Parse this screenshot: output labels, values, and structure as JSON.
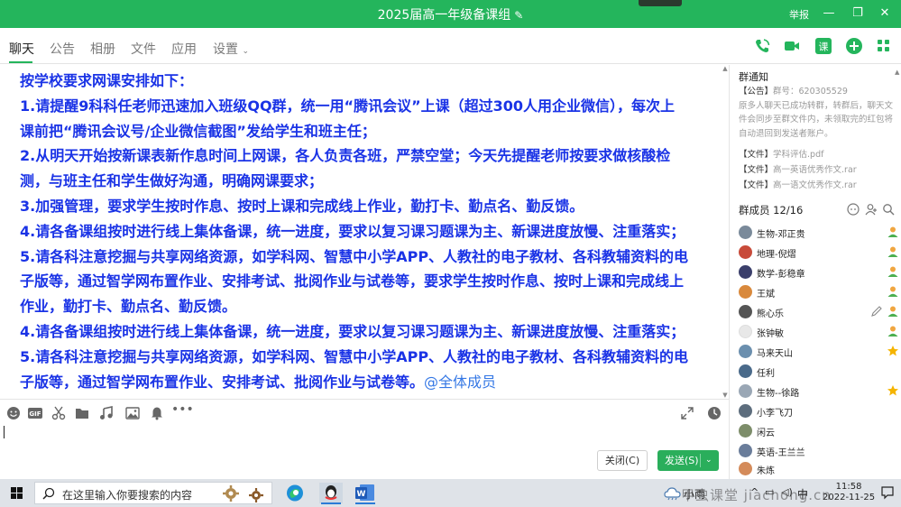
{
  "window": {
    "title": "2025届高一年级备课组",
    "report": "举报",
    "colors": {
      "titlebar": "#24b55c",
      "message": "#1a33e6",
      "send": "#2aae5b"
    }
  },
  "tabs": [
    "聊天",
    "公告",
    "相册",
    "文件",
    "应用",
    "设置"
  ],
  "message": {
    "lines": [
      "按学校要求网课安排如下：",
      "1.请提醒9科科任老师迅速加入班级QQ群，统一用“腾讯会议”上课（超过300人用企业微信），每次上",
      "课前把“腾讯会议号/企业微信截图”发给学生和班主任；",
      "2.从明天开始按新课表新作息时间上网课，各人负责各班，严禁空堂；今天先提醒老师按要求做核酸检",
      "测，与班主任和学生做好沟通，明确网课要求；",
      "3.加强管理，要求学生按时作息、按时上课和完成线上作业，勤打卡、勤点名、勤反馈。",
      "4.请各备课组按时进行线上集体备课，统一进度，要求以复习课习题课为主、新课进度放慢、注重落实；",
      "5.请各科注意挖掘与共享网络资源，如学科网、智慧中小学APP、人教社的电子教材、各科教辅资料的电",
      "子版等，通过智学网布置作业、安排考试、批阅作业与试卷等，要求学生按时作息、按时上课和完成线上",
      "作业，勤打卡、勤点名、勤反馈。",
      "4.请各备课组按时进行线上集体备课，统一进度，要求以复习课习题课为主、新课进度放慢、注重落实；",
      "5.请各科注意挖掘与共享网络资源，如学科网、智慧中小学APP、人教社的电子教材、各科教辅资料的电",
      "子版等，通过智学网布置作业、安排考试、批阅作业与试卷等。"
    ],
    "mention": "@全体成员"
  },
  "buttons": {
    "close": "关闭(C)",
    "send": "发送(S)"
  },
  "side": {
    "notice_title": "群通知",
    "notice_tag": "【公告】",
    "notice_group_label": "群号：620305529",
    "notice_body": "原多人聊天已成功转群，转群后，聊天文件会同步至群文件内，未领取完的红包将自动退回到发送者账户。",
    "files": [
      {
        "tag": "【文件】",
        "name": "学科评估.pdf"
      },
      {
        "tag": "【文件】",
        "name": "高一英语优秀作文.rar"
      },
      {
        "tag": "【文件】",
        "name": "高一语文优秀作文.rar"
      }
    ],
    "members_title": "群成员 12/16",
    "members": [
      {
        "name": "生物-邓正贵",
        "role": "admin-icon",
        "av": "#7a8a9a"
      },
      {
        "name": "地理-倪熠",
        "role": "admin-icon",
        "av": "#c84b3a"
      },
      {
        "name": "数学-彭稳章",
        "role": "admin-icon",
        "av": "#3b3f6b"
      },
      {
        "name": "王斌",
        "role": "admin-icon",
        "av": "#d9893c"
      },
      {
        "name": "熊心乐",
        "role": "admin-icon",
        "av": "#555555"
      },
      {
        "name": "张钟敏",
        "role": "admin-icon",
        "av": "#e8e8e8"
      },
      {
        "name": "马来天山",
        "role": "owner-star-icon",
        "av": "#6b8fae"
      },
      {
        "name": "任利",
        "role": "",
        "av": "#4a6a8a"
      },
      {
        "name": "生物--徐路",
        "role": "owner-star-icon",
        "av": "#9aa7b5"
      },
      {
        "name": "小李飞刀",
        "role": "",
        "av": "#5d6d7d"
      },
      {
        "name": "闲云",
        "role": "",
        "av": "#7d8d6a"
      },
      {
        "name": "英语-王兰兰",
        "role": "",
        "av": "#6a7d9a"
      },
      {
        "name": "朱炼",
        "role": "",
        "av": "#d48b5a"
      }
    ]
  },
  "taskbar": {
    "search_placeholder": "在这里输入你要搜索的内容",
    "weather": "小雨",
    "time": "11:58",
    "date": "2022-11-25",
    "watermark": "甲虫课堂 jiachong.cn"
  }
}
